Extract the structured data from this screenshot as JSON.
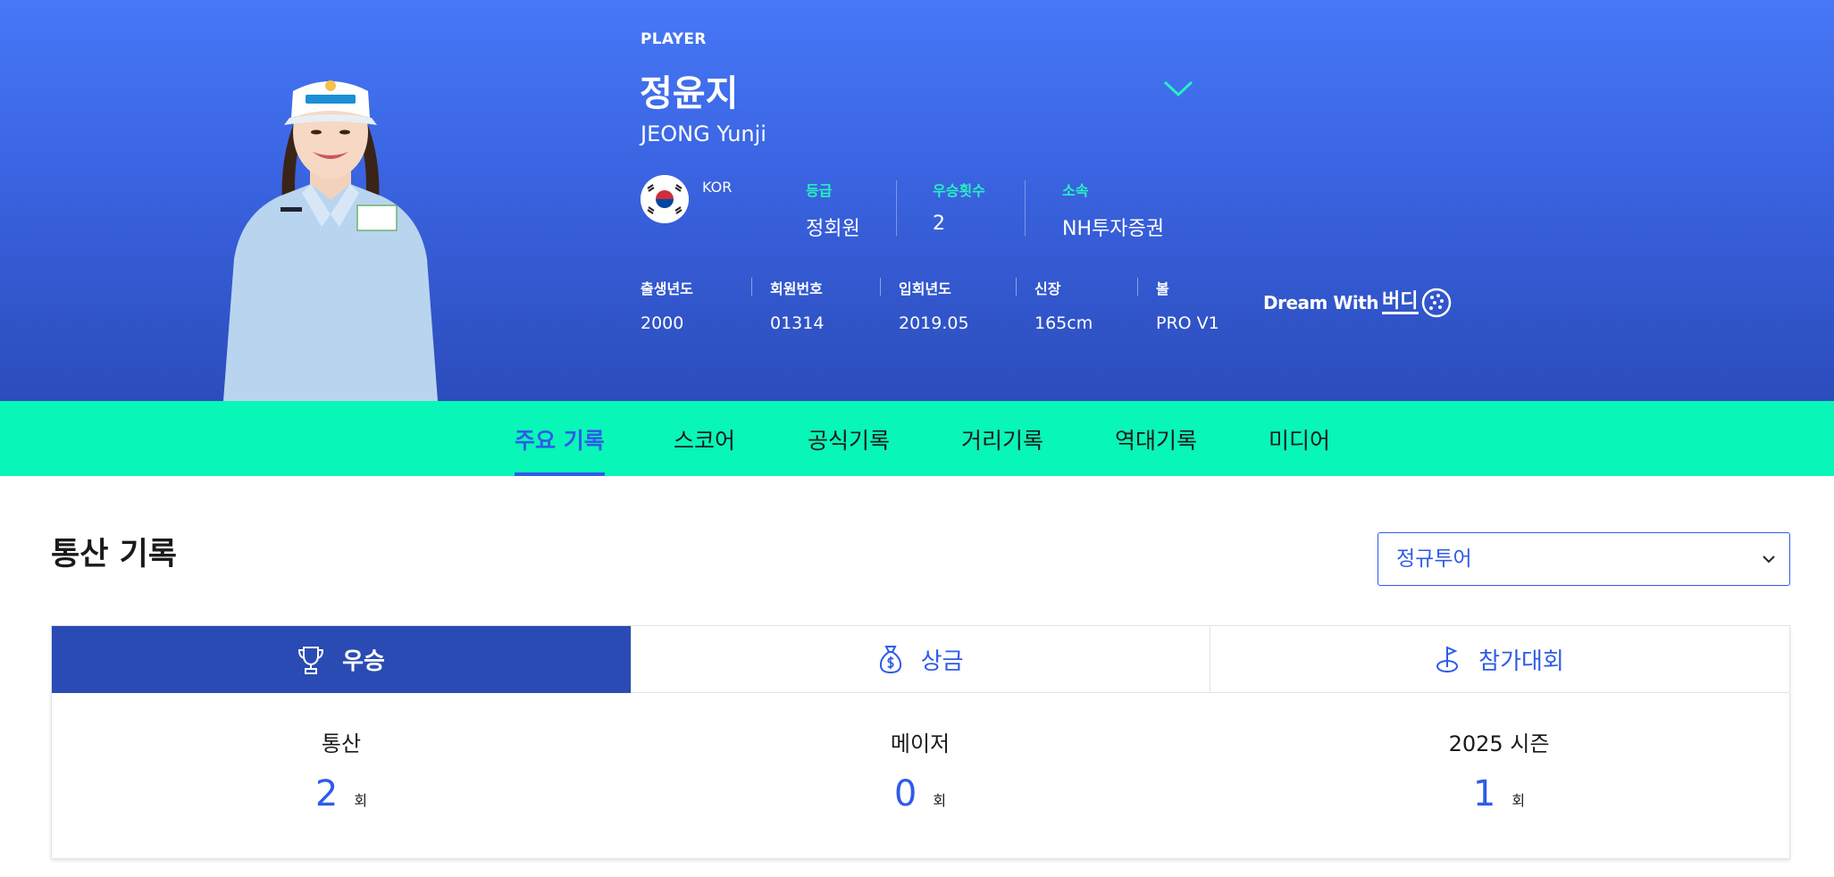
{
  "player": {
    "label": "PLAYER",
    "name_ko": "정윤지",
    "name_en": "JEONG Yunji",
    "nation": "KOR",
    "grade_label": "등급",
    "grade": "정회원",
    "wins_label": "우승횟수",
    "wins": "2",
    "team_label": "소속",
    "team": "NH투자증권"
  },
  "meta": {
    "birth_label": "출생년도",
    "birth": "2000",
    "member_label": "회원번호",
    "member": "01314",
    "join_label": "입회년도",
    "join": "2019.05",
    "height_label": "신장",
    "height": "165cm",
    "ball_label": "볼",
    "ball": "PRO V1"
  },
  "sponsor_logo": {
    "line1": "Dream With",
    "line2": "버디"
  },
  "tabs": [
    "주요 기록",
    "스코어",
    "공식기록",
    "거리기록",
    "역대기록",
    "미디어"
  ],
  "section": {
    "title": "통산 기록",
    "tour_select": "정규투어"
  },
  "subtabs": [
    {
      "label": "우승",
      "icon": "trophy-icon"
    },
    {
      "label": "상금",
      "icon": "money-bag-icon"
    },
    {
      "label": "참가대회",
      "icon": "golf-flag-icon"
    }
  ],
  "stats": [
    {
      "label": "통산",
      "value": "2",
      "unit": "회"
    },
    {
      "label": "메이저",
      "value": "0",
      "unit": "회"
    },
    {
      "label": "2025 시즌",
      "value": "1",
      "unit": "회"
    }
  ],
  "colors": {
    "accent": "#2f5be8",
    "tab_bar": "#08f6b8",
    "active_subtab": "#2a4bb4",
    "info_label": "#28f0c0"
  }
}
